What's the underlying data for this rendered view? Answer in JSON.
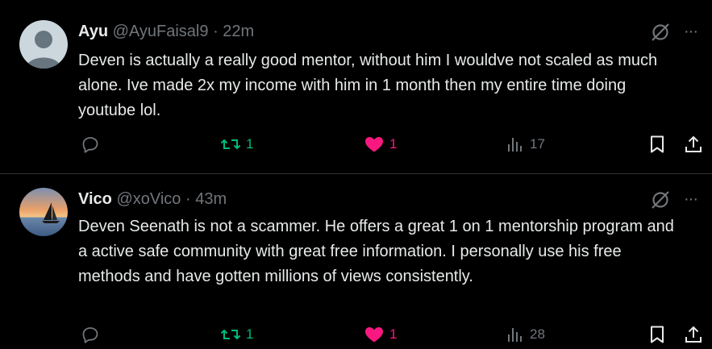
{
  "tweets": [
    {
      "name": "Ayu",
      "handle": "@AyuFaisal9",
      "dot": "·",
      "time": "22m",
      "text": "Deven is actually a really good mentor, without him I wouldve not scaled as much alone. Ive made 2x my income with him in 1 month then my entire time doing youtube lol.",
      "retweets": "1",
      "likes": "1",
      "views": "17",
      "more": "···"
    },
    {
      "name": "Vico",
      "handle": "@xoVico",
      "dot": "·",
      "time": "43m",
      "text": "Deven Seenath is not a scammer. He offers a great 1 on 1 mentorship program and a active safe community with great free information. I personally use his free methods and have gotten millions of views consistently.",
      "retweets": "1",
      "likes": "1",
      "views": "28",
      "more": "···"
    }
  ],
  "colors": {
    "background": "#000000",
    "text": "#e7e9ea",
    "muted": "#71767b",
    "retweet": "#00ba7c",
    "like": "#f91880",
    "divider": "#2f3336"
  },
  "icons": [
    "reply-icon",
    "retweet-icon",
    "like-icon",
    "views-icon",
    "bookmark-icon",
    "share-icon",
    "grok-icon",
    "more-icon"
  ]
}
